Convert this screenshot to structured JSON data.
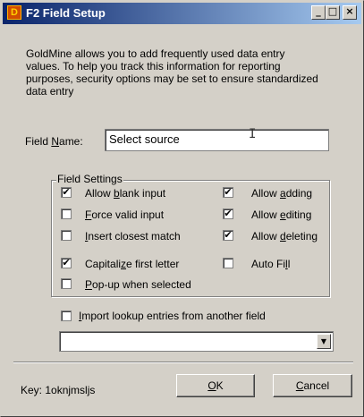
{
  "window": {
    "title": "F2 Field Setup",
    "icon": "goldmine-icon",
    "controls": [
      "_",
      "□",
      "×"
    ]
  },
  "description": "GoldMine allows you to add frequently used data entry values. To help you track this information for reporting purposes, security options may be set to ensure standardized data entry",
  "field_name": {
    "label_pre": "Field ",
    "label_mnemonic": "N",
    "label_post": "ame:",
    "value": "Select source"
  },
  "field_settings": {
    "title": "Field Settings",
    "left": [
      {
        "pre": "Allow ",
        "mn": "b",
        "post": "lank input",
        "checked": true
      },
      {
        "pre": "",
        "mn": "F",
        "post": "orce valid input",
        "checked": false
      },
      {
        "pre": "",
        "mn": "I",
        "post": "nsert closest match",
        "checked": false
      },
      {
        "pre": "Capitali",
        "mn": "z",
        "post": "e first letter",
        "checked": true
      },
      {
        "pre": "",
        "mn": "P",
        "post": "op-up when selected",
        "checked": false
      }
    ],
    "right": [
      {
        "pre": "Allow ",
        "mn": "a",
        "post": "dding",
        "checked": true
      },
      {
        "pre": "Allow ",
        "mn": "e",
        "post": "diting",
        "checked": true
      },
      {
        "pre": "Allow ",
        "mn": "d",
        "post": "eleting",
        "checked": true
      },
      {
        "pre": "Auto Fi",
        "mn": "l",
        "post": "l",
        "checked": false
      }
    ]
  },
  "import": {
    "pre": "",
    "mn": "I",
    "post": "mport lookup entries from another field",
    "checked": false
  },
  "combo": {
    "value": ""
  },
  "footer": {
    "key_label": "Key: 1oknjmsljs",
    "ok": {
      "mn": "O",
      "post": "K"
    },
    "cancel": {
      "mn": "C",
      "post": "ancel"
    }
  }
}
